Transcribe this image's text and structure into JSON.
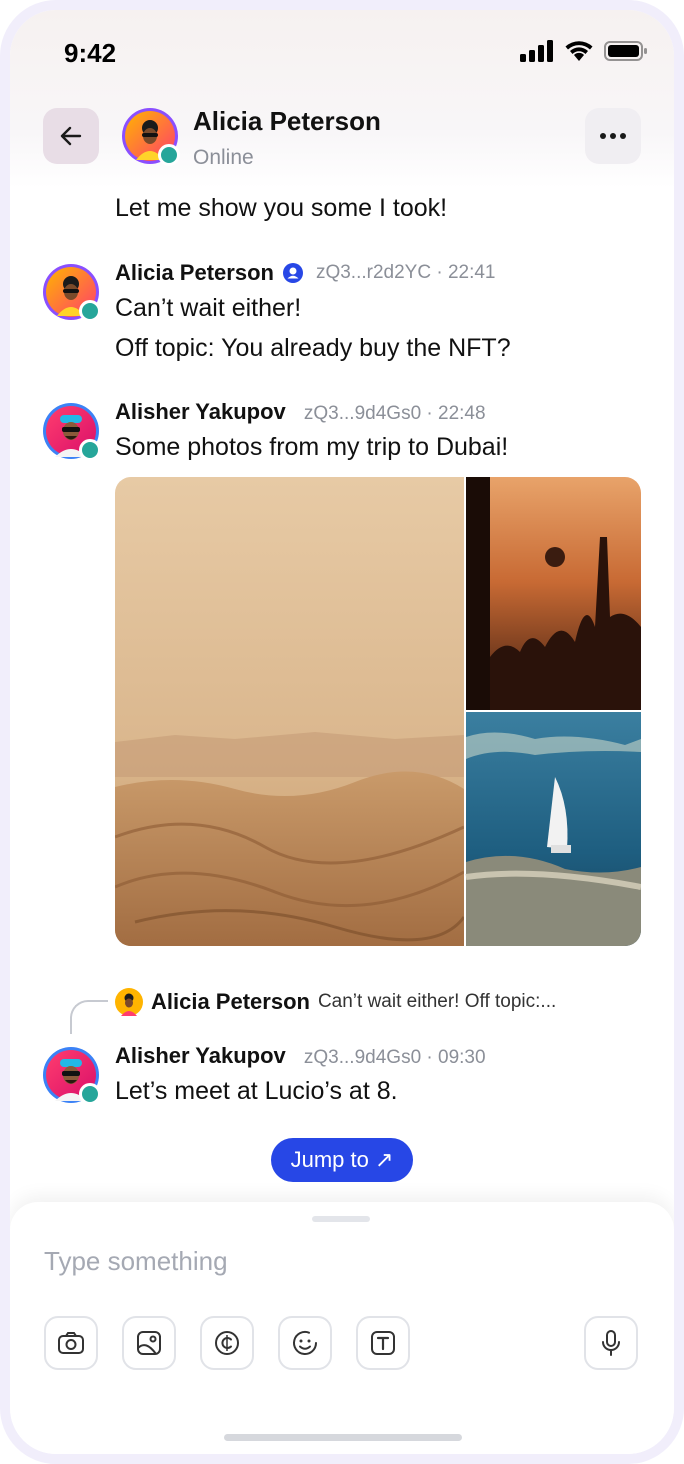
{
  "status": {
    "time": "9:42"
  },
  "header": {
    "name": "Alicia Peterson",
    "status": "Online"
  },
  "messages": [
    {
      "text": "Let me show you some I took!"
    },
    {
      "author": "Alicia Peterson",
      "meta": "zQ3...r2d2YC · 22:41",
      "lines": [
        "Can’t wait either!",
        "Off topic: You already buy the NFT?"
      ]
    },
    {
      "author": "Alisher Yakupov",
      "meta": "zQ3...9d4Gs0 · 22:48",
      "lines": [
        "Some photos from my trip to Dubai!"
      ]
    },
    {
      "author": "Alisher Yakupov",
      "meta": "zQ3...9d4Gs0 · 09:30",
      "lines": [
        "Let’s meet at Lucio’s at 8."
      ]
    }
  ],
  "reply": {
    "author": "Alicia Peterson",
    "text": "Can’t wait either! Off topic:..."
  },
  "jump": {
    "label": "Jump to ↗"
  },
  "composer": {
    "placeholder": "Type something"
  },
  "colors": {
    "accent": "#2747e6",
    "online": "#26a69a"
  },
  "icons": [
    "back-arrow-icon",
    "more-icon",
    "camera-icon",
    "image-icon",
    "copyright-icon",
    "emoji-icon",
    "text-format-icon",
    "microphone-icon",
    "verified-icon"
  ]
}
